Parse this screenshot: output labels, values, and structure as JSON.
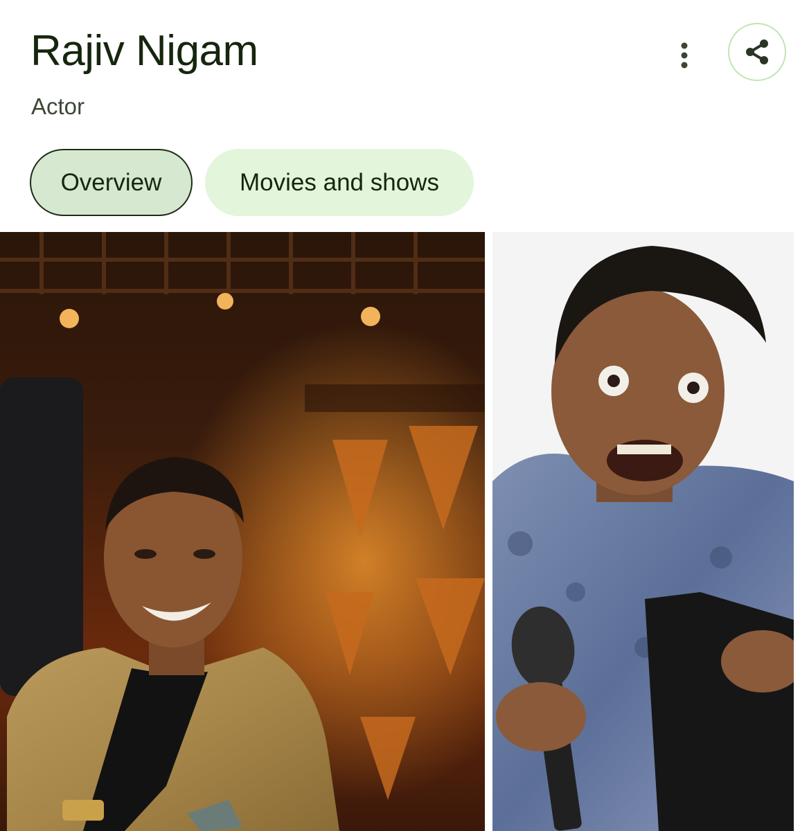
{
  "header": {
    "title": "Rajiv Nigam",
    "subtitle": "Actor",
    "more_icon": "more-vert-icon",
    "share_icon": "share-icon",
    "accent_color": "#bfe6b3"
  },
  "tabs": [
    {
      "label": "Overview",
      "selected": true
    },
    {
      "label": "Movies and shows",
      "selected": false
    }
  ],
  "images": [
    {
      "subject": "person-photo"
    },
    {
      "subject": "person-photo"
    }
  ],
  "colors": {
    "chip_selected_bg": "#d6e8cf",
    "chip_bg": "#e3f5db",
    "text_primary": "#16260e"
  }
}
